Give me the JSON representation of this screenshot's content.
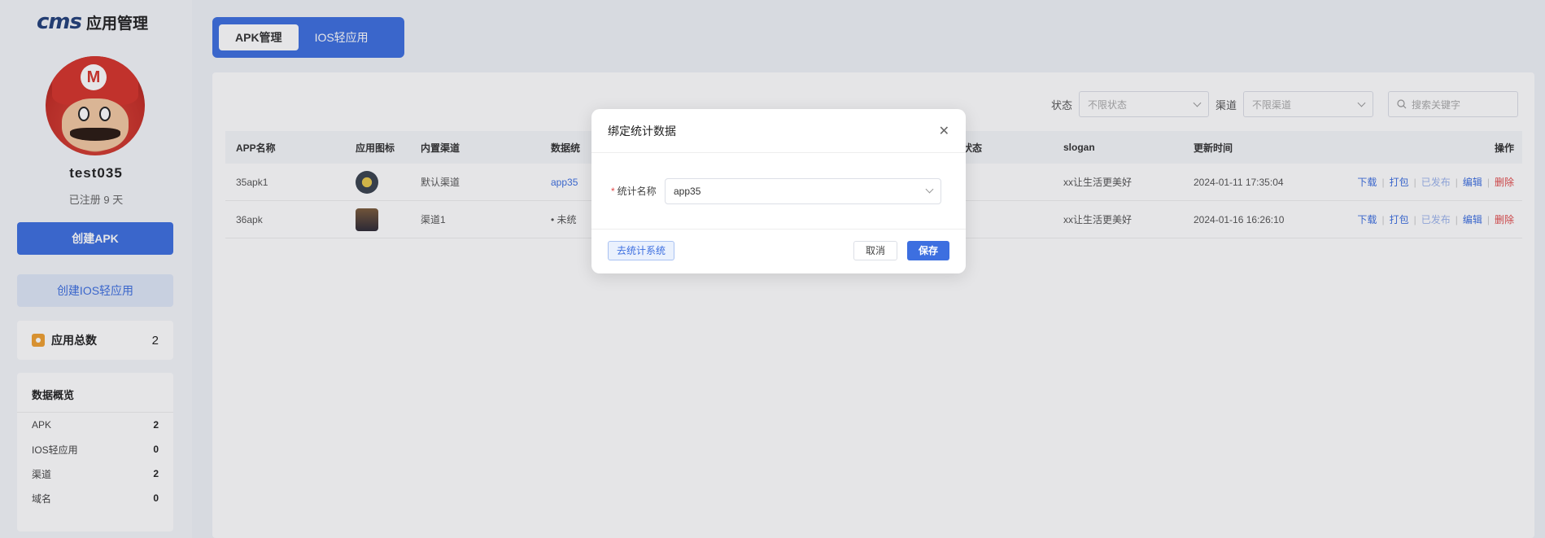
{
  "logo": {
    "mark": "cms",
    "title": "应用管理"
  },
  "user": {
    "name": "test035",
    "registered": "已注册 9 天"
  },
  "sidebar": {
    "create_apk": "创建APK",
    "create_ios": "创建IOS轻应用",
    "total_label": "应用总数",
    "total_value": "2",
    "overview_title": "数据概览",
    "stats": [
      {
        "label": "APK",
        "value": "2"
      },
      {
        "label": "IOS轻应用",
        "value": "0"
      },
      {
        "label": "渠道",
        "value": "2"
      },
      {
        "label": "域名",
        "value": "0"
      }
    ]
  },
  "tabs": [
    {
      "label": "APK管理"
    },
    {
      "label": "IOS轻应用"
    }
  ],
  "filters": {
    "status_label": "状态",
    "status_placeholder": "不限状态",
    "channel_label": "渠道",
    "channel_placeholder": "不限渠道",
    "search_placeholder": "搜索关键字"
  },
  "table": {
    "headers": [
      "APP名称",
      "应用图标",
      "内置渠道",
      "数据统",
      "",
      "新版本状态",
      "slogan",
      "更新时间",
      "操作"
    ],
    "rows": [
      {
        "name": "35apk1",
        "channel": "默认渠道",
        "stats": "app35",
        "status": "已发布",
        "slogan": "xx让生活更美好",
        "updated": "2024-01-11 17:35:04"
      },
      {
        "name": "36apk",
        "channel": "渠道1",
        "stats": "• 未统",
        "status": "已发布",
        "slogan": "xx让生活更美好",
        "updated": "2024-01-16 16:26:10"
      }
    ],
    "ops": {
      "download": "下载",
      "pack": "打包",
      "published": "已发布",
      "edit": "编辑",
      "delete": "删除"
    }
  },
  "modal": {
    "title": "绑定统计数据",
    "field_label": "统计名称",
    "field_value": "app35",
    "goto": "去统计系统",
    "cancel": "取消",
    "save": "保存"
  }
}
